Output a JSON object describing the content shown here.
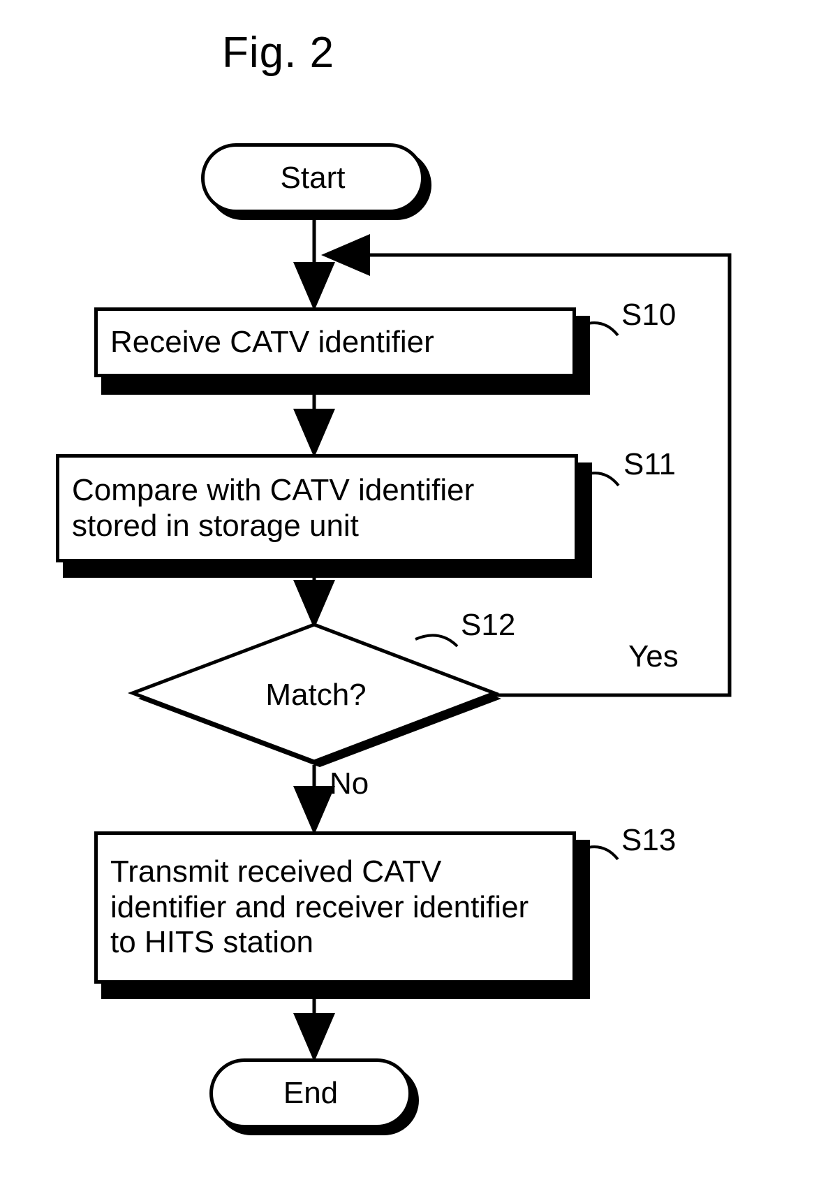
{
  "title": "Fig. 2",
  "nodes": {
    "start": "Start",
    "s10": "Receive CATV identifier",
    "s11": "Compare with CATV identifier stored in storage unit",
    "s12": "Match?",
    "s13": "Transmit received CATV identifier and receiver identifier to HITS station",
    "end": "End"
  },
  "step_labels": {
    "s10": "S10",
    "s11": "S11",
    "s12": "S12",
    "s13": "S13"
  },
  "edges": {
    "yes": "Yes",
    "no": "No"
  }
}
